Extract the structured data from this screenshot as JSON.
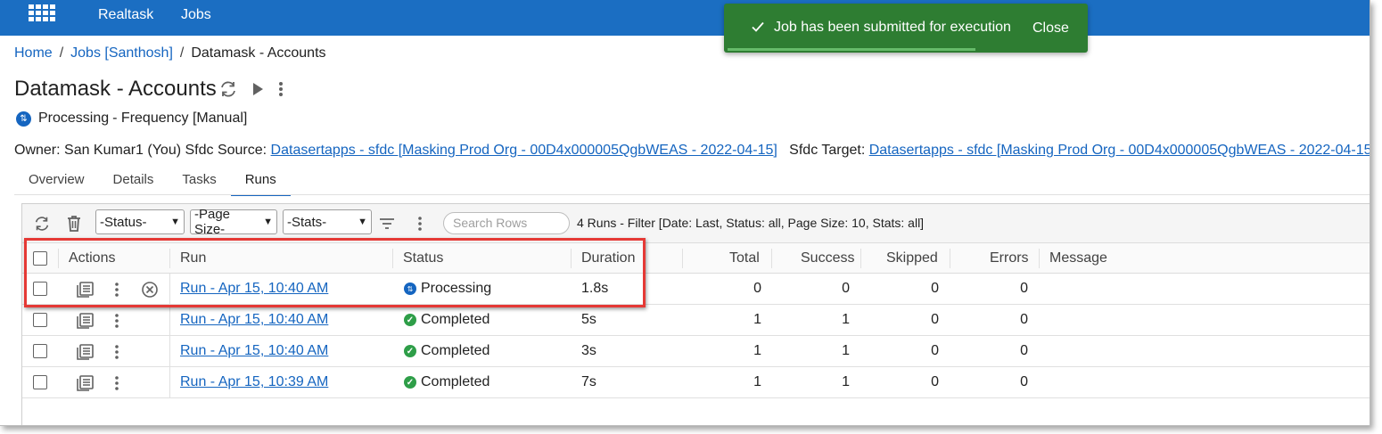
{
  "topbar": {
    "nav": [
      "Realtask",
      "Jobs"
    ],
    "apps_icon": "grid-apps-icon",
    "color": "#1b6ec2"
  },
  "toast": {
    "message": "Job has been submitted for execution",
    "close_label": "Close",
    "icon": "check-icon",
    "color": "#2e7d32"
  },
  "breadcrumb": {
    "items": [
      "Home",
      "Jobs [Santhosh]",
      "Datamask - Accounts"
    ],
    "separator": "/"
  },
  "job": {
    "title": "Datamask - Accounts",
    "status": "Processing",
    "frequency": " - Frequency [Manual]",
    "owner_prefix": "Owner: San Kumar1 (You) Sfdc Source: ",
    "source_link": "Datasertapps - sfdc [Masking Prod Org - 00D4x000005QgbWEAS - 2022-04-15]",
    "target_prefix": "Sfdc Target: ",
    "target_link": "Datasertapps - sfdc [Masking Prod Org - 00D4x000005QgbWEAS - 2022-04-15]"
  },
  "tabs": [
    {
      "label": "Overview",
      "active": false
    },
    {
      "label": "Details",
      "active": false
    },
    {
      "label": "Tasks",
      "active": false
    },
    {
      "label": "Runs",
      "active": true
    }
  ],
  "toolbar": {
    "status_select": "-Status-",
    "page_size_select": "-Page Size-",
    "stats_select": "-Stats-",
    "search_placeholder": "Search Rows",
    "filter_summary": "4 Runs - Filter [Date: Last, Status: all, Page Size: 10, Stats: all]"
  },
  "table": {
    "headers": {
      "actions": "Actions",
      "run": "Run",
      "status": "Status",
      "duration": "Duration",
      "total": "Total",
      "success": "Success",
      "skipped": "Skipped",
      "errors": "Errors",
      "message": "Message"
    },
    "rows": [
      {
        "run": "Run - Apr 15, 10:40 AM",
        "status": "Processing",
        "duration": "1.8s",
        "total": "0",
        "success": "0",
        "skipped": "0",
        "errors": "0",
        "message": "",
        "cancelable": true
      },
      {
        "run": "Run - Apr 15, 10:40 AM",
        "status": "Completed",
        "duration": "5s",
        "total": "1",
        "success": "1",
        "skipped": "0",
        "errors": "0",
        "message": "",
        "cancelable": false
      },
      {
        "run": "Run - Apr 15, 10:40 AM",
        "status": "Completed",
        "duration": "3s",
        "total": "1",
        "success": "1",
        "skipped": "0",
        "errors": "0",
        "message": "",
        "cancelable": false
      },
      {
        "run": "Run - Apr 15, 10:39 AM",
        "status": "Completed",
        "duration": "7s",
        "total": "1",
        "success": "1",
        "skipped": "0",
        "errors": "0",
        "message": "",
        "cancelable": false
      }
    ]
  },
  "colors": {
    "link": "#1565c0",
    "completed": "#2e9e48",
    "processing": "#1565c0",
    "highlight": "#e53935"
  }
}
